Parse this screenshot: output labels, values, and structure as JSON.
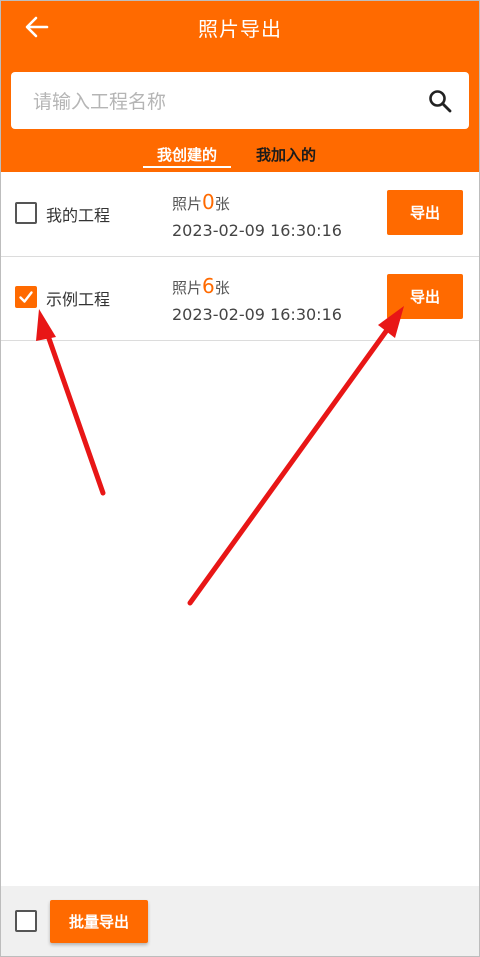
{
  "header": {
    "title": "照片导出",
    "back_icon": "arrow-left-icon"
  },
  "search": {
    "placeholder": "请输入工程名称",
    "value": "",
    "icon": "search-icon"
  },
  "tabs": [
    {
      "label": "我创建的",
      "active": true
    },
    {
      "label": "我加入的",
      "active": false
    }
  ],
  "projects": [
    {
      "name": "我的工程",
      "checked": false,
      "photo_prefix": "照片",
      "photo_count": "0",
      "photo_suffix": "张",
      "datetime": "2023-02-09 16:30:16",
      "export_label": "导出"
    },
    {
      "name": "示例工程",
      "checked": true,
      "photo_prefix": "照片",
      "photo_count": "6",
      "photo_suffix": "张",
      "datetime": "2023-02-09 16:30:16",
      "export_label": "导出"
    }
  ],
  "footer": {
    "select_all_checked": false,
    "batch_export_label": "批量导出"
  },
  "colors": {
    "accent": "#ff6a00",
    "annotation_arrow": "#e81616"
  }
}
